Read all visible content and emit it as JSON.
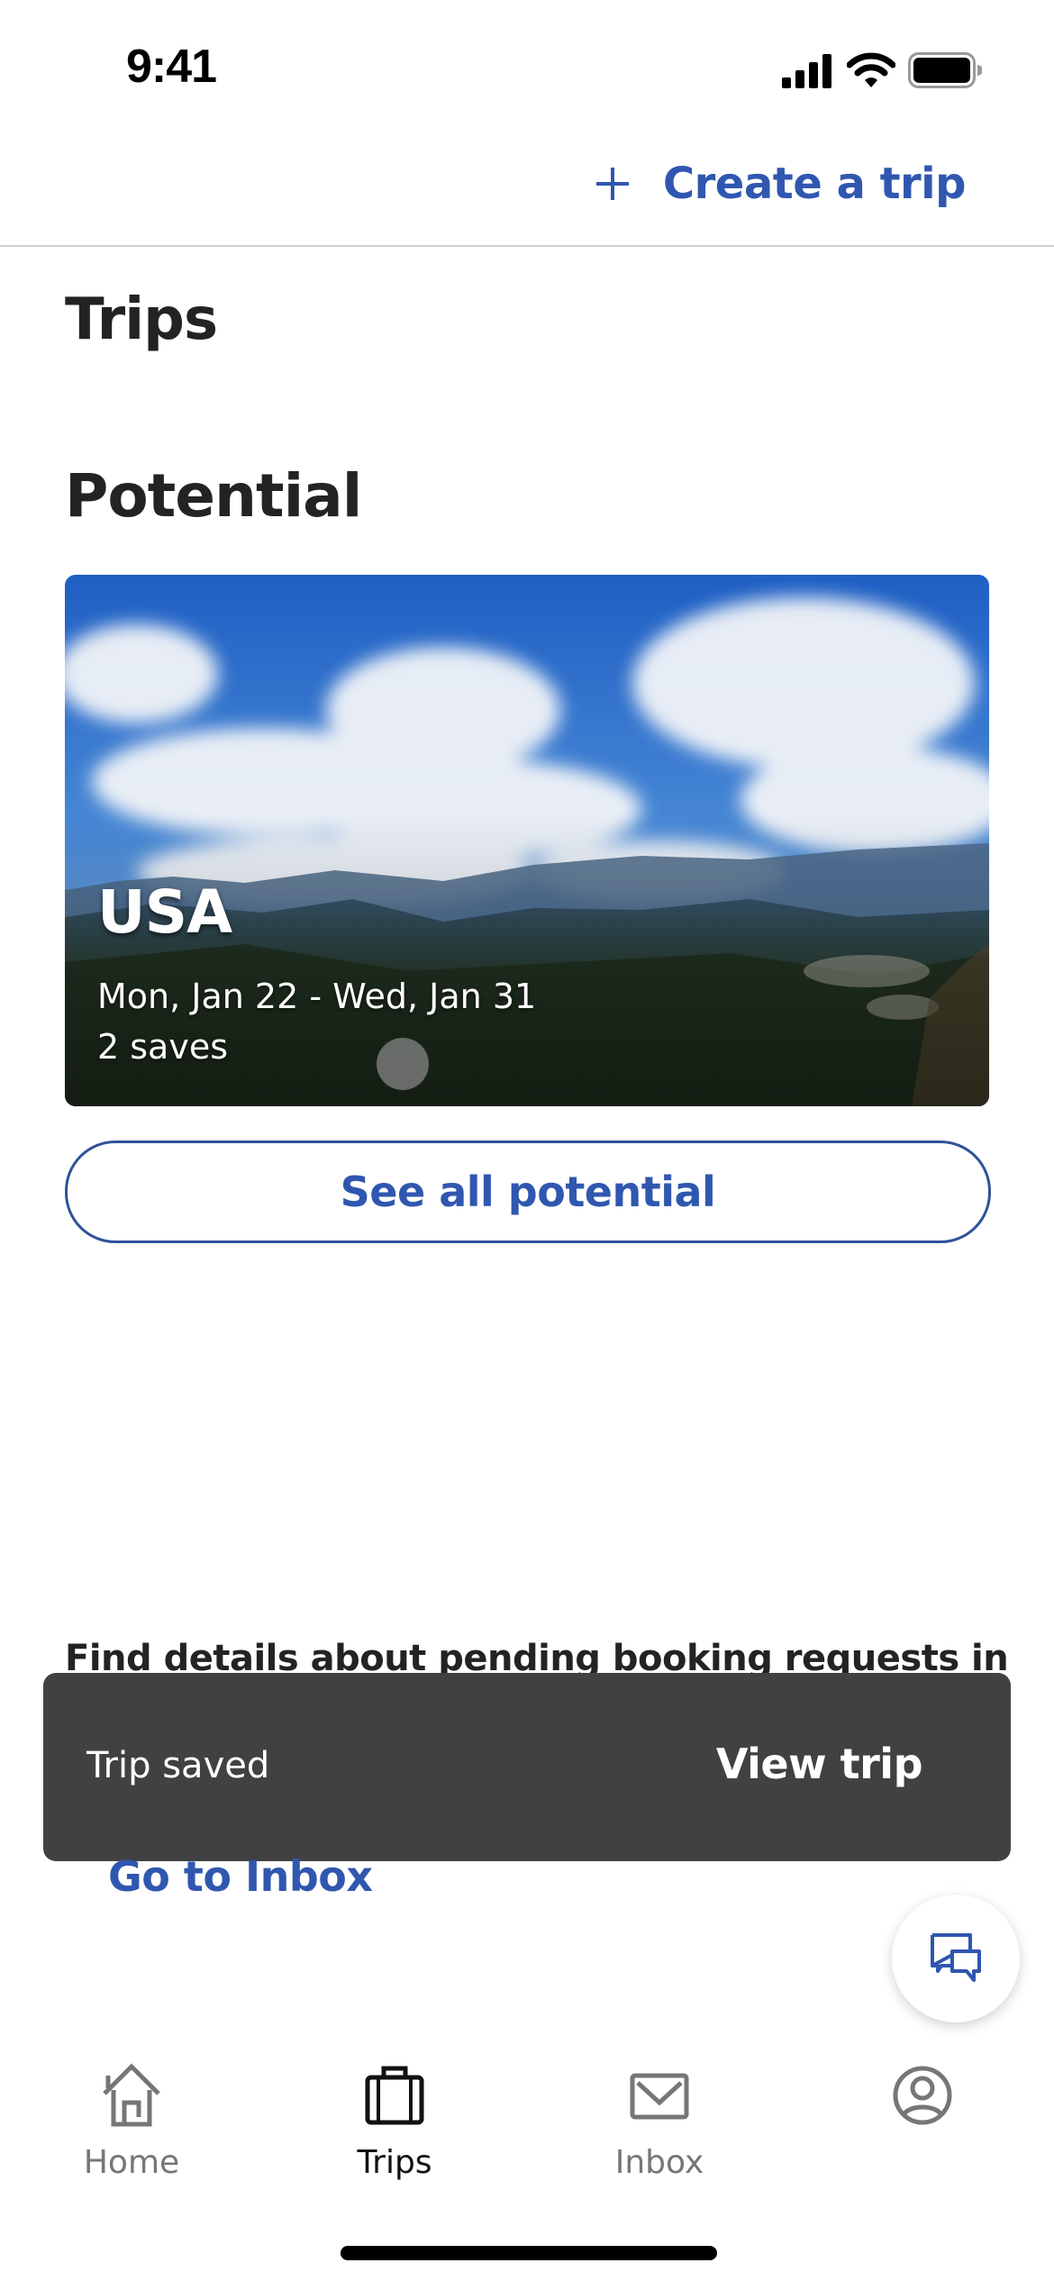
{
  "status_bar": {
    "time": "9:41"
  },
  "header": {
    "create_trip_label": "Create a trip"
  },
  "page": {
    "title": "Trips",
    "section_title": "Potential"
  },
  "trip_card": {
    "destination": "USA",
    "dates": "Mon, Jan 22 - Wed, Jan 31",
    "saves": "2 saves"
  },
  "see_all_button": "See all potential",
  "pending": {
    "text": "Find details about pending booking requests in",
    "link": "Go to Inbox"
  },
  "toast": {
    "message": "Trip saved",
    "action": "View trip",
    "background": "#414042"
  },
  "tab_bar": {
    "items": [
      {
        "label": "Home",
        "icon": "home-icon",
        "active": false
      },
      {
        "label": "Trips",
        "icon": "suitcase-icon",
        "active": true
      },
      {
        "label": "Inbox",
        "icon": "mail-icon",
        "active": false
      },
      {
        "label": "",
        "icon": "profile-icon",
        "active": false
      }
    ]
  },
  "colors": {
    "accent": "#3057b0",
    "text": "#232323",
    "inactive": "#767676"
  }
}
